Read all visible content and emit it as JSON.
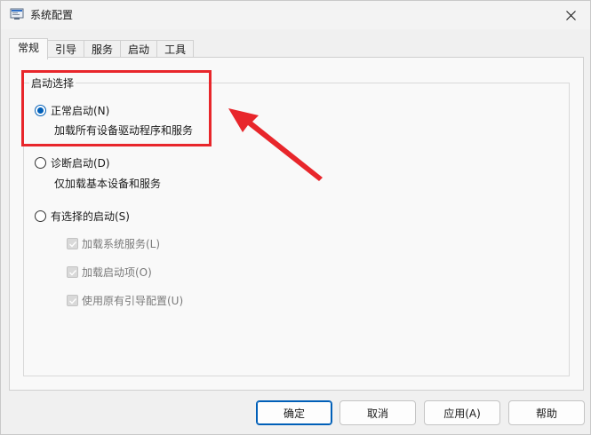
{
  "window": {
    "title": "系统配置",
    "app_icon": "msconfig-icon",
    "close_icon": "close-icon"
  },
  "tabs": [
    {
      "label": "常规",
      "active": true
    },
    {
      "label": "引导",
      "active": false
    },
    {
      "label": "服务",
      "active": false
    },
    {
      "label": "启动",
      "active": false
    },
    {
      "label": "工具",
      "active": false
    }
  ],
  "startup_selection": {
    "group_label": "启动选择",
    "normal": {
      "label": "正常启动(N)",
      "desc": "加载所有设备驱动程序和服务",
      "checked": true
    },
    "diagnostic": {
      "label": "诊断启动(D)",
      "desc": "仅加载基本设备和服务",
      "checked": false
    },
    "selective": {
      "label": "有选择的启动(S)",
      "checked": false,
      "options": [
        {
          "label": "加载系统服务(L)",
          "checked": true,
          "disabled": true
        },
        {
          "label": "加载启动项(O)",
          "checked": true,
          "disabled": true
        },
        {
          "label": "使用原有引导配置(U)",
          "checked": true,
          "disabled": true
        }
      ]
    }
  },
  "buttons": {
    "ok": "确定",
    "cancel": "取消",
    "apply": "应用(A)",
    "help": "帮助"
  },
  "colors": {
    "accent": "#005fb8",
    "annotation": "#e8262b"
  }
}
